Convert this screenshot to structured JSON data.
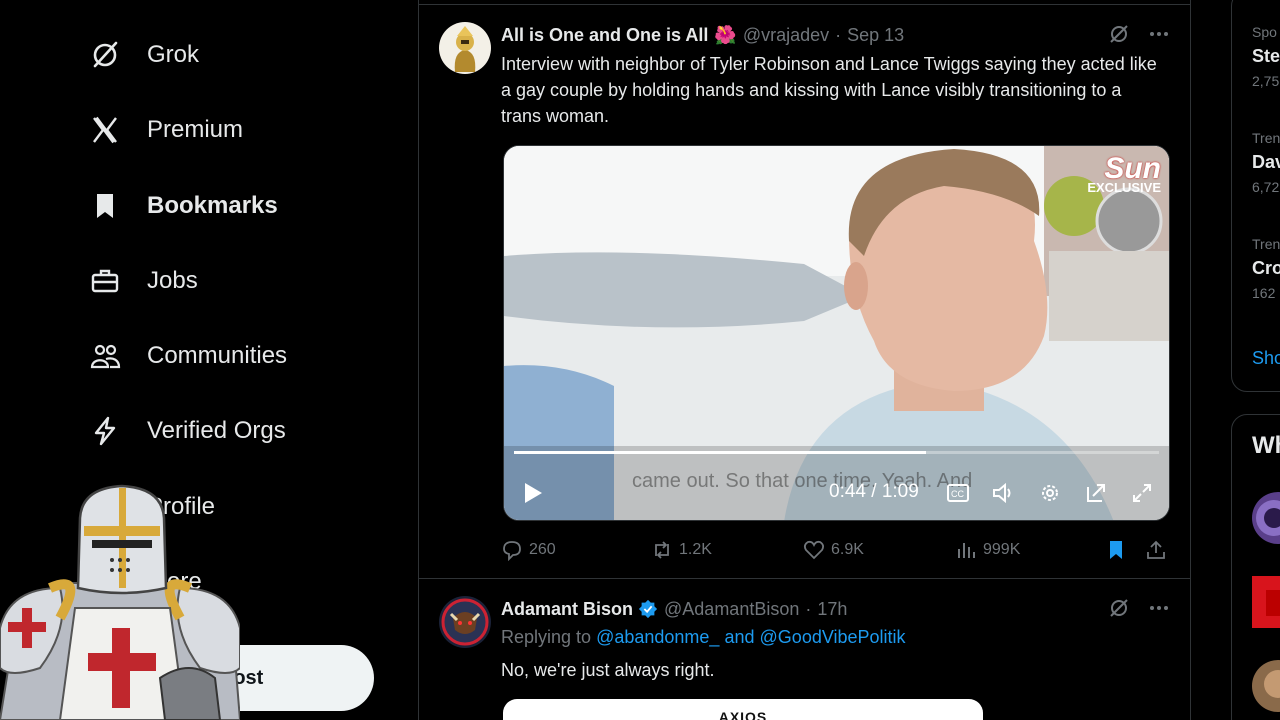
{
  "nav": {
    "items": [
      {
        "label": "Grok",
        "icon": "grok-icon"
      },
      {
        "label": "Premium",
        "icon": "x-logo-icon"
      },
      {
        "label": "Bookmarks",
        "icon": "bookmark-icon",
        "active": true
      },
      {
        "label": "Jobs",
        "icon": "briefcase-icon"
      },
      {
        "label": "Communities",
        "icon": "communities-icon"
      },
      {
        "label": "Verified Orgs",
        "icon": "lightning-icon"
      },
      {
        "label": "Profile",
        "icon": "profile-icon"
      },
      {
        "label": "More",
        "icon": "more-icon"
      }
    ],
    "post_label": "Post"
  },
  "tweet1": {
    "name": "All is One and One is All",
    "emoji": "🌺",
    "handle": "@vrajadev",
    "dot": "·",
    "time": "Sep 13",
    "text": "Interview with neighbor of Tyler Robinson and Lance Twiggs saying they acted like a gay couple by holding hands and kissing with Lance visibly transitioning to a trans woman.",
    "video": {
      "time_display": "0:44 / 1:09",
      "progress": 0.638,
      "subtitle": "came out. So that one time. Yeah. And",
      "watermark_title": "Sun",
      "watermark_sub": "EXCLUSIVE"
    },
    "stats": {
      "replies": "260",
      "reposts": "1.2K",
      "likes": "6.9K",
      "views": "999K"
    }
  },
  "tweet2": {
    "name": "Adamant Bison",
    "handle": "@AdamantBison",
    "dot": "·",
    "time": "17h",
    "reply_prefix": "Replying to",
    "mention1": "@abandonme_",
    "reply_and": "and",
    "mention2": "@GoodVibePolitik",
    "text": "No, we're just always right.",
    "card_brand": "AXIOS"
  },
  "sidebar": {
    "trends": [
      {
        "cat": "Spo",
        "topic": "Ste",
        "count": "2,75"
      },
      {
        "cat": "Tren",
        "topic": "Dav",
        "count": "6,72"
      },
      {
        "cat": "Tren",
        "topic": "Cro",
        "count": "162"
      }
    ],
    "show_more": "Sho",
    "who_title": "Wh"
  },
  "colors": {
    "accent": "#1d9bf0",
    "background": "#000000",
    "border": "#2f3336",
    "muted": "#71767b"
  }
}
